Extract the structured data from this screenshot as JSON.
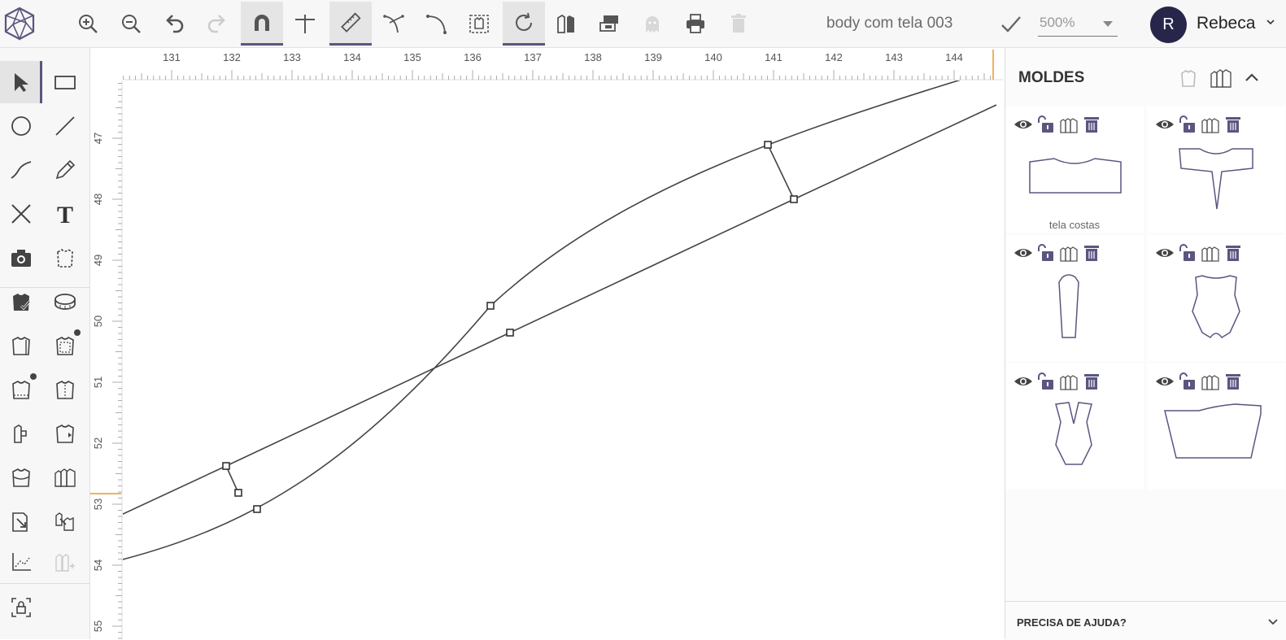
{
  "header": {
    "doc_title": "body com tela 003",
    "zoom_value": "500%",
    "user_initial": "R",
    "user_name": "Rebeca",
    "tools": [
      "zoom-in-icon",
      "zoom-out-icon",
      "undo-icon",
      "redo-icon",
      "magnet-icon",
      "cross-guide-icon",
      "ruler-icon",
      "curve-split-icon",
      "curve-corner-icon",
      "select-bounds-icon",
      "rotate-icon",
      "pattern-pieces-icon",
      "fabric-layout-icon",
      "ghost-icon",
      "print-icon",
      "trash-icon"
    ]
  },
  "left_tools": [
    "select-arrow-icon",
    "rectangle-icon",
    "circle-icon",
    "line-icon",
    "curve-icon",
    "pencil-icon",
    "x-cross-icon",
    "text-icon",
    "camera-icon",
    "garment-edit-icon",
    "garment-check-icon",
    "measuring-tape-icon",
    "shirt-front-icon",
    "shirt-back-icon",
    "shirt-hem-icon",
    "shirt-center-icon",
    "shirt-pocket-icon",
    "shirt-sleeve-icon",
    "body-piece-icon",
    "multiple-pieces-icon",
    "export-piece-icon",
    "import-piece-icon",
    "graph-icon",
    "pieces-add-icon",
    "lock-frame-icon"
  ],
  "ruler": {
    "h_labels": [
      "131",
      "132",
      "133",
      "134",
      "135",
      "136",
      "137",
      "138",
      "139",
      "140",
      "141",
      "142",
      "143",
      "144"
    ],
    "v_labels": [
      "47",
      "48",
      "49",
      "50",
      "51",
      "52",
      "53",
      "54",
      "55"
    ]
  },
  "panel": {
    "title": "MOLDES",
    "help_label": "PRECISA DE AJUDA?",
    "cards": [
      {
        "name": "tela costas"
      },
      {
        "name": ""
      },
      {
        "name": ""
      },
      {
        "name": ""
      },
      {
        "name": ""
      },
      {
        "name": ""
      }
    ]
  },
  "colors": {
    "accent": "#5a5680",
    "avatar": "#27264a",
    "piece_stroke": "#5a5680"
  }
}
